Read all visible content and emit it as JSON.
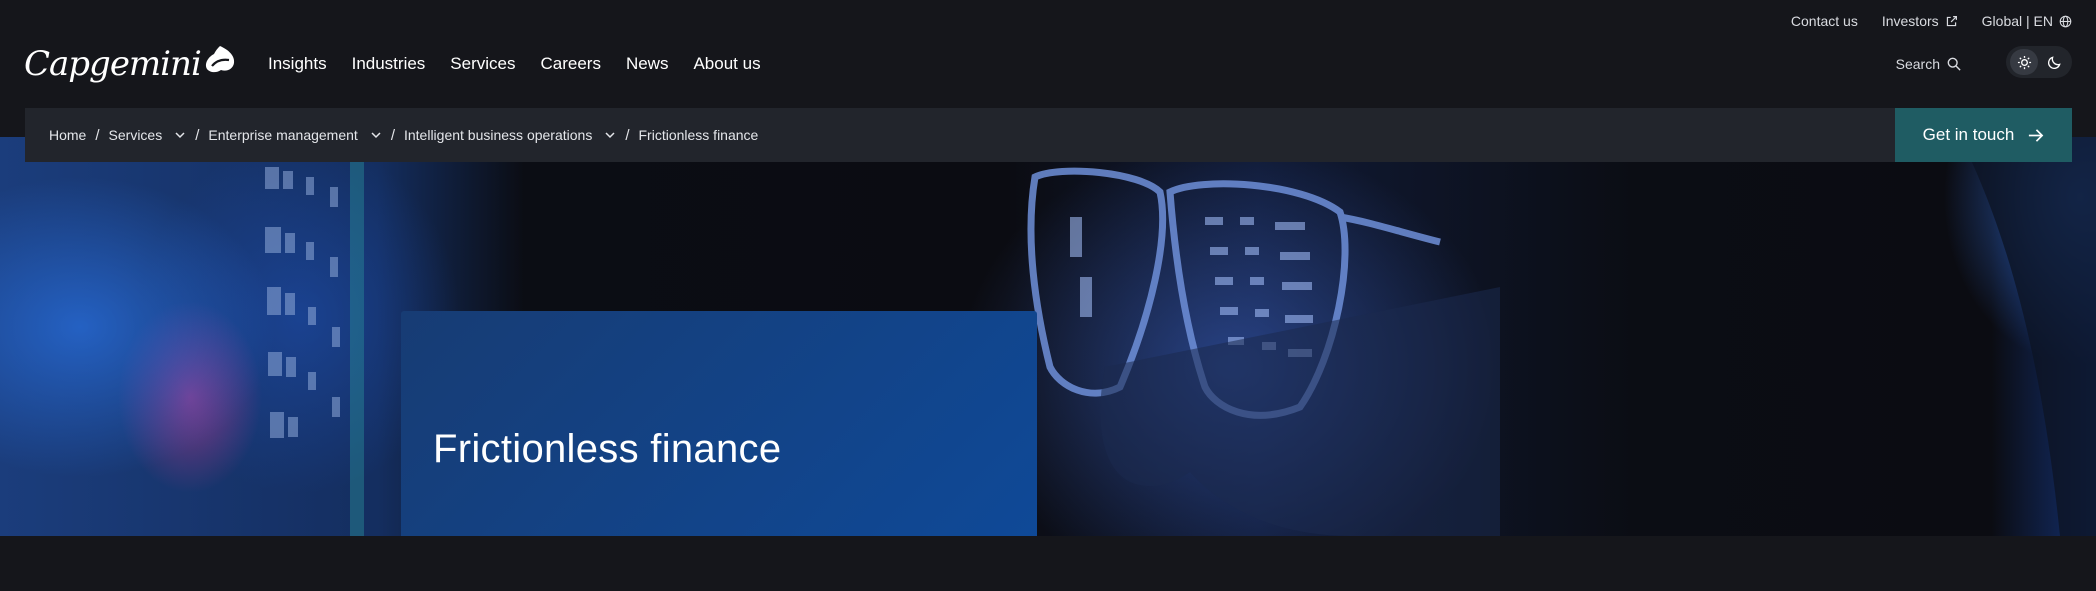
{
  "brand": {
    "logo_text": "Capgemini"
  },
  "utility_nav": {
    "contact": "Contact us",
    "investors": "Investors",
    "locale": "Global | EN"
  },
  "main_nav": {
    "items": [
      "Insights",
      "Industries",
      "Services",
      "Careers",
      "News",
      "About us"
    ]
  },
  "search": {
    "label": "Search"
  },
  "breadcrumb": {
    "items": [
      {
        "label": "Home"
      },
      {
        "label": "Services"
      },
      {
        "label": "Enterprise management"
      },
      {
        "label": "Intelligent business operations"
      },
      {
        "label": "Frictionless finance"
      }
    ]
  },
  "cta": {
    "label": "Get in touch"
  },
  "hero": {
    "title": "Frictionless finance"
  },
  "colors": {
    "page_bg": "#15161b",
    "breadcrumb_bg": "#22252c",
    "cta_bg": "#1f5c63",
    "title_card_start": "#173c74",
    "title_card_end": "#0e4a9a"
  }
}
